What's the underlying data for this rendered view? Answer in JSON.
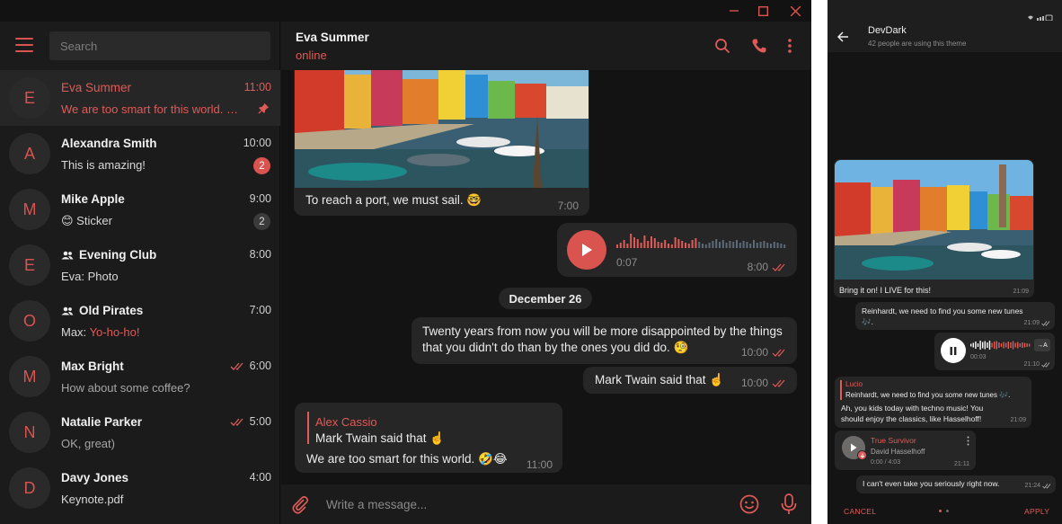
{
  "window": {
    "colors": {
      "accent": "#e05b57",
      "bg": "#181818",
      "bubble": "#262626"
    }
  },
  "sidebar": {
    "search_placeholder": "Search",
    "chats": [
      {
        "avatar": "E",
        "name": "Eva Summer",
        "time": "11:00",
        "preview": "We are too smart for this world. 🤣😂",
        "pinned": true,
        "active": true
      },
      {
        "avatar": "A",
        "name": "Alexandra Smith",
        "time": "10:00",
        "preview": "This is amazing!",
        "badge": "2"
      },
      {
        "avatar": "M",
        "name": "Mike Apple",
        "time": "9:00",
        "preview": "😊 Sticker",
        "badge": "2"
      },
      {
        "avatar": "E",
        "name": "Evening Club",
        "time": "8:00",
        "preview": "Eva: Photo",
        "group": true
      },
      {
        "avatar": "O",
        "name": "Old Pirates",
        "time": "7:00",
        "preview_sender": "Max:",
        "preview_text": "Yo-ho-ho!",
        "group": true
      },
      {
        "avatar": "M",
        "name": "Max Bright",
        "time": "6:00",
        "preview": "How about some coffee?",
        "read": true
      },
      {
        "avatar": "N",
        "name": "Natalie Parker",
        "time": "5:00",
        "preview": "OK, great)",
        "read": true
      },
      {
        "avatar": "D",
        "name": "Davy Jones",
        "time": "4:00",
        "preview": "Keynote.pdf"
      }
    ]
  },
  "chat": {
    "title": "Eva Summer",
    "status": "online",
    "messages": {
      "photo_caption": "To reach a port, we must sail. 🤓",
      "photo_time": "7:00",
      "voice_duration": "0:07",
      "voice_time": "8:00",
      "date_separator": "December 26",
      "quote1_line1": "Twenty years from now you will be more disappointed by the things",
      "quote1_line2": "that you didn't do than by the ones you did do. 🧐",
      "quote1_time": "10:00",
      "quote2": "Mark Twain said that ☝️",
      "quote2_time": "10:00",
      "reply_author": "Alex Cassio",
      "reply_text": "Mark Twain said that ☝️",
      "reply_msg": "We are too smart for this world. 🤣😂",
      "reply_time": "11:00"
    },
    "composer_placeholder": "Write a message..."
  },
  "phone": {
    "title": "DevDark",
    "subtitle": "42 people are using this theme",
    "photo_caption": "Bring it on! I LIVE for this!",
    "photo_time": "21:09",
    "msg1_line1": "Reinhardt, we need to find you some new tunes",
    "msg1_line2": "🎶.",
    "msg1_time": "21:09",
    "voice_duration": "00:03",
    "voice_time": "21:10",
    "voice_translate": "→A",
    "reply_author": "Lucio",
    "reply_quote": "Reinhardt, we need to find you some new tunes 🎶.",
    "reply_line1": "Ah, you kids today with techno music! You",
    "reply_line2": "should enjoy the classics, like Hasselhoff!",
    "reply_time": "21:09",
    "music_title": "True Survivor",
    "music_artist": "David Hasselhoff",
    "music_duration": "0:00 / 4:03",
    "music_time": "21:11",
    "last_msg": "I can't even take you seriously right now.",
    "last_time": "21:24",
    "cancel": "CANCEL",
    "apply": "APPLY"
  }
}
